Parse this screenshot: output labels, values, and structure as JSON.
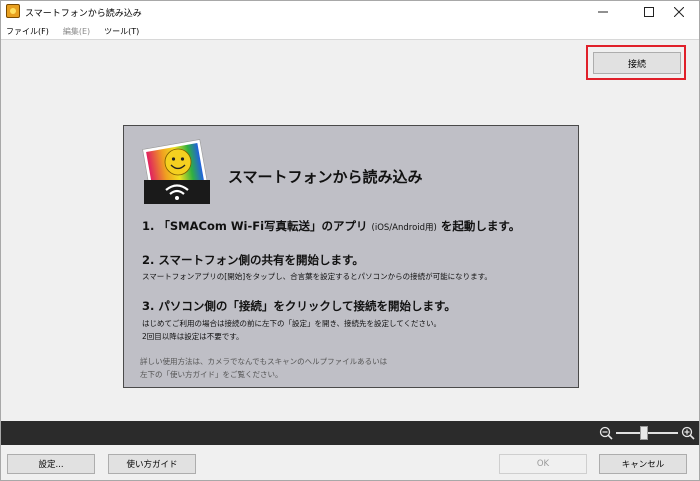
{
  "window": {
    "title": "スマートフォンから読み込み"
  },
  "menu": [
    {
      "label": "ファイル(F)",
      "enabled": true
    },
    {
      "label": "編集(E)",
      "enabled": false
    },
    {
      "label": "ツール(T)",
      "enabled": true
    }
  ],
  "toolbar": {
    "connect_label": "接続"
  },
  "card": {
    "title": "スマートフォンから読み込み",
    "step1": {
      "heading_main": "1. 「SMACom Wi-Fi写真転送」のアプリ",
      "heading_small": "(iOS/Android用)",
      "heading_end": "を起動します。"
    },
    "step2": {
      "heading": "2. スマートフォン側の共有を開始します。",
      "desc": "スマートフォンアプリの[開始]をタップし、合言葉を設定するとパソコンからの接続が可能になります。"
    },
    "step3": {
      "heading": "3. パソコン側の「接続」をクリックして接続を開始します。",
      "desc1": "はじめてご利用の場合は接続の前に左下の「設定」を開き、接続先を設定してください。",
      "desc2": "2回目以降は設定は不要です。"
    },
    "note1": "詳しい使用方法は、カメラでなんでもスキャンのヘルプファイルあるいは",
    "note2": "左下の「使い方ガイド」をご覧ください。"
  },
  "zoom": {
    "level": 0.45
  },
  "buttons": {
    "settings": "設定...",
    "guide": "使い方ガイド",
    "ok": "OK",
    "cancel": "キャンセル"
  },
  "colors": {
    "highlight": "#e0202a",
    "card_bg": "#bfbfc6",
    "darkbar": "#2b2b2b"
  }
}
